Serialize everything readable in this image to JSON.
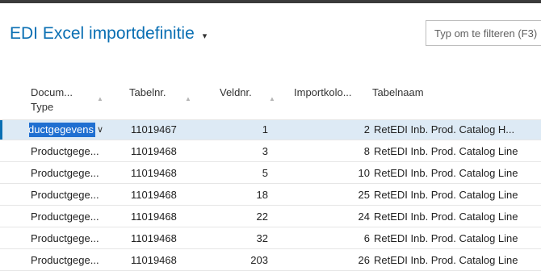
{
  "page": {
    "title": "EDI Excel importdefinitie",
    "filter_placeholder": "Typ om te filteren (F3)"
  },
  "columns": {
    "doc_line1": "Docum...",
    "doc_line2": "Type",
    "tabelnr": "Tabelnr.",
    "veldnr": "Veldnr.",
    "importkolom": "Importkolo...",
    "tabelnaam": "Tabelnaam"
  },
  "rows": [
    {
      "doc": "Productgegevens",
      "tabelnr": "11019467",
      "veldnr": "1",
      "importkolom": "2",
      "tabelnaam": "RetEDI Inb. Prod. Catalog H..."
    },
    {
      "doc": "Productgege...",
      "tabelnr": "11019468",
      "veldnr": "3",
      "importkolom": "8",
      "tabelnaam": "RetEDI Inb. Prod. Catalog Line"
    },
    {
      "doc": "Productgege...",
      "tabelnr": "11019468",
      "veldnr": "5",
      "importkolom": "10",
      "tabelnaam": "RetEDI Inb. Prod. Catalog Line"
    },
    {
      "doc": "Productgege...",
      "tabelnr": "11019468",
      "veldnr": "18",
      "importkolom": "25",
      "tabelnaam": "RetEDI Inb. Prod. Catalog Line"
    },
    {
      "doc": "Productgege...",
      "tabelnr": "11019468",
      "veldnr": "22",
      "importkolom": "24",
      "tabelnaam": "RetEDI Inb. Prod. Catalog Line"
    },
    {
      "doc": "Productgege...",
      "tabelnr": "11019468",
      "veldnr": "32",
      "importkolom": "6",
      "tabelnaam": "RetEDI Inb. Prod. Catalog Line"
    },
    {
      "doc": "Productgege...",
      "tabelnr": "11019468",
      "veldnr": "203",
      "importkolom": "26",
      "tabelnaam": "RetEDI Inb. Prod. Catalog Line"
    }
  ]
}
